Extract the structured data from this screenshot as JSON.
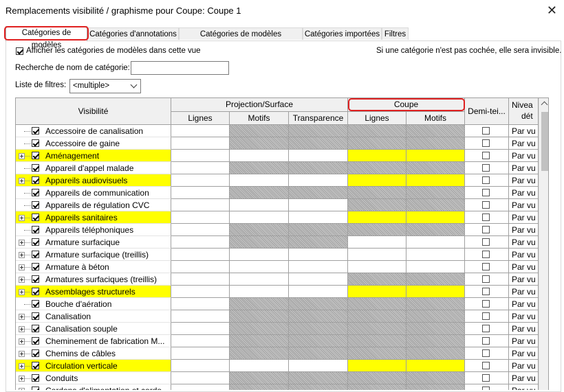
{
  "window": {
    "title": "Remplacements visibilité / graphisme pour Coupe: Coupe 1",
    "close": "✕"
  },
  "tabs": [
    {
      "label": "Catégories de modèles",
      "active": true
    },
    {
      "label": "Catégories d'annotations",
      "active": false
    },
    {
      "label": "Catégories de modèles analytiques",
      "active": false
    },
    {
      "label": "Catégories importées",
      "active": false
    },
    {
      "label": "Filtres",
      "active": false
    }
  ],
  "options": {
    "show_categories_label": "Afficher les catégories de modèles dans cette vue",
    "show_categories_checked": true,
    "hint": "Si une catégorie n'est pas cochée, elle sera invisible.",
    "search_label": "Recherche de nom de catégorie:",
    "search_value": "",
    "filter_list_label": "Liste de filtres:",
    "filter_list_value": "<multiple>"
  },
  "grid": {
    "header": {
      "visibility": "Visibilité",
      "projection_group": "Projection/Surface",
      "coupe_group": "Coupe",
      "demi_teinte": "Demi-tei...",
      "niveau": "Nivea",
      "niveau_line2": "dét",
      "proj_lignes": "Lignes",
      "proj_motifs": "Motifs",
      "proj_transparence": "Transparence",
      "coupe_lignes": "Lignes",
      "coupe_motifs": "Motifs"
    },
    "rows": [
      {
        "name": "Accessoire de canalisation",
        "checked": true,
        "expandable": false,
        "highlight": false,
        "proj_motifs_hatch": true,
        "transp_hatch": true,
        "coupe_hatch": true,
        "niveau": "Par vu"
      },
      {
        "name": "Accessoire de gaine",
        "checked": true,
        "expandable": false,
        "highlight": false,
        "proj_motifs_hatch": true,
        "transp_hatch": true,
        "coupe_hatch": true,
        "niveau": "Par vu"
      },
      {
        "name": "Aménagement",
        "checked": true,
        "expandable": true,
        "highlight": true,
        "proj_motifs_hatch": false,
        "transp_hatch": false,
        "coupe_hatch": false,
        "niveau": "Par vu"
      },
      {
        "name": "Appareil d'appel malade",
        "checked": true,
        "expandable": false,
        "highlight": false,
        "proj_motifs_hatch": true,
        "transp_hatch": true,
        "coupe_hatch": true,
        "niveau": "Par vu"
      },
      {
        "name": "Appareils audiovisuels",
        "checked": true,
        "expandable": true,
        "highlight": true,
        "proj_motifs_hatch": false,
        "transp_hatch": false,
        "coupe_hatch": false,
        "niveau": "Par vu"
      },
      {
        "name": "Appareils de communication",
        "checked": true,
        "expandable": false,
        "highlight": false,
        "proj_motifs_hatch": true,
        "transp_hatch": true,
        "coupe_hatch": true,
        "niveau": "Par vu"
      },
      {
        "name": "Appareils de régulation CVC",
        "checked": true,
        "expandable": false,
        "highlight": false,
        "proj_motifs_hatch": false,
        "transp_hatch": false,
        "coupe_hatch": true,
        "niveau": "Par vu"
      },
      {
        "name": "Appareils sanitaires",
        "checked": true,
        "expandable": true,
        "highlight": true,
        "proj_motifs_hatch": false,
        "transp_hatch": false,
        "coupe_hatch": false,
        "niveau": "Par vu"
      },
      {
        "name": "Appareils téléphoniques",
        "checked": true,
        "expandable": false,
        "highlight": false,
        "proj_motifs_hatch": true,
        "transp_hatch": true,
        "coupe_hatch": true,
        "niveau": "Par vu"
      },
      {
        "name": "Armature surfacique",
        "checked": true,
        "expandable": true,
        "highlight": false,
        "proj_motifs_hatch": true,
        "transp_hatch": true,
        "coupe_hatch": false,
        "niveau": "Par vu"
      },
      {
        "name": "Armature surfacique (treillis)",
        "checked": true,
        "expandable": true,
        "highlight": false,
        "proj_motifs_hatch": false,
        "transp_hatch": false,
        "coupe_hatch": false,
        "niveau": "Par vu"
      },
      {
        "name": "Armature à béton",
        "checked": true,
        "expandable": true,
        "highlight": false,
        "proj_motifs_hatch": false,
        "transp_hatch": false,
        "coupe_hatch": false,
        "niveau": "Par vu"
      },
      {
        "name": "Armatures surfaciques (treillis)",
        "checked": true,
        "expandable": true,
        "highlight": false,
        "proj_motifs_hatch": false,
        "transp_hatch": false,
        "coupe_hatch": true,
        "niveau": "Par vu"
      },
      {
        "name": "Assemblages structurels",
        "checked": true,
        "expandable": true,
        "highlight": true,
        "proj_motifs_hatch": false,
        "transp_hatch": false,
        "coupe_hatch": false,
        "niveau": "Par vu"
      },
      {
        "name": "Bouche d'aération",
        "checked": true,
        "expandable": false,
        "highlight": false,
        "proj_motifs_hatch": true,
        "transp_hatch": true,
        "coupe_hatch": true,
        "niveau": "Par vu"
      },
      {
        "name": "Canalisation",
        "checked": true,
        "expandable": true,
        "highlight": false,
        "proj_motifs_hatch": true,
        "transp_hatch": true,
        "coupe_hatch": true,
        "niveau": "Par vu"
      },
      {
        "name": "Canalisation souple",
        "checked": true,
        "expandable": true,
        "highlight": false,
        "proj_motifs_hatch": true,
        "transp_hatch": true,
        "coupe_hatch": true,
        "niveau": "Par vu"
      },
      {
        "name": "Cheminement de fabrication M...",
        "checked": true,
        "expandable": true,
        "highlight": false,
        "proj_motifs_hatch": true,
        "transp_hatch": true,
        "coupe_hatch": true,
        "niveau": "Par vu"
      },
      {
        "name": "Chemins de câbles",
        "checked": true,
        "expandable": true,
        "highlight": false,
        "proj_motifs_hatch": true,
        "transp_hatch": true,
        "coupe_hatch": true,
        "niveau": "Par vu"
      },
      {
        "name": "Circulation verticale",
        "checked": true,
        "expandable": true,
        "highlight": true,
        "proj_motifs_hatch": false,
        "transp_hatch": false,
        "coupe_hatch": false,
        "niveau": "Par vu"
      },
      {
        "name": "Conduits",
        "checked": true,
        "expandable": true,
        "highlight": false,
        "proj_motifs_hatch": true,
        "transp_hatch": true,
        "coupe_hatch": true,
        "niveau": "Par vu"
      },
      {
        "name": "Cordons d'alimentation et cordo...",
        "checked": true,
        "expandable": true,
        "highlight": false,
        "proj_motifs_hatch": true,
        "transp_hatch": true,
        "coupe_hatch": true,
        "niveau": "Par vu"
      }
    ]
  }
}
